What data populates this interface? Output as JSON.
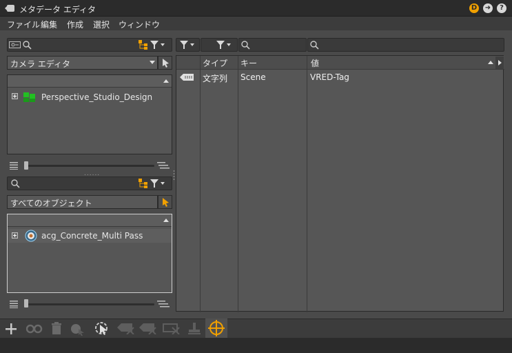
{
  "window": {
    "title": "メタデータ エディタ"
  },
  "menu": [
    "ファイル",
    "編集",
    "作成",
    "選択",
    "ウィンドウ"
  ],
  "left_top": {
    "search_placeholder": "",
    "camera_combo": "カメラ エディタ",
    "tree_items": [
      {
        "label": "Perspective_Studio_Design"
      }
    ]
  },
  "left_bottom": {
    "search_placeholder": "",
    "objects_combo": "すべてのオブジェクト",
    "tree_items": [
      {
        "label": "acg_Concrete_Multi Pass"
      }
    ]
  },
  "table": {
    "headers": {
      "type": "タイプ",
      "key": "キー",
      "value": "値"
    },
    "rows": [
      {
        "type": "文字列",
        "key": "Scene",
        "value": "VRED-Tag"
      }
    ]
  },
  "colors": {
    "accent": "#f0a000",
    "titlebar": "#2b2b2b",
    "panel": "#565656",
    "tree_icon_green": "#22c022"
  },
  "icons": [
    "back-icon",
    "d-badge-icon",
    "forward-icon",
    "help-icon",
    "filter-icon",
    "search-icon",
    "hierarchy-icon",
    "pointer-icon",
    "tag-icon",
    "add-icon",
    "target-icon"
  ]
}
